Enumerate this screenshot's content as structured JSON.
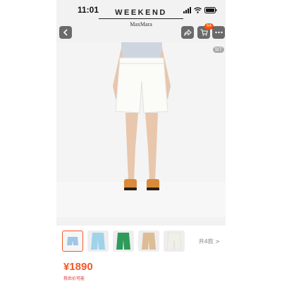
{
  "status_bar": {
    "time": "11:01"
  },
  "header": {
    "brand_line1": "WEEKEND",
    "brand_line2": "MaxMara",
    "cart_badge": "64"
  },
  "gallery": {
    "indicator": "5/7"
  },
  "thumbnails": {
    "items": [
      {
        "name": "thumb-white-shorts-set",
        "color": "#e9eef5",
        "selected": true
      },
      {
        "name": "thumb-light-blue-shorts",
        "color": "#9fd3ea",
        "selected": false
      },
      {
        "name": "thumb-green-shorts",
        "color": "#2f9a5a",
        "selected": false
      },
      {
        "name": "thumb-beige-shorts",
        "color": "#dcbd96",
        "selected": false
      },
      {
        "name": "thumb-ivory-shorts",
        "color": "#f1efe8",
        "selected": false
      }
    ],
    "count_label": "共4款 >"
  },
  "price": {
    "value": "¥1890",
    "subtext": "券后价可能"
  },
  "colors": {
    "accent": "#f25a2a",
    "badge": "#ff5000"
  }
}
